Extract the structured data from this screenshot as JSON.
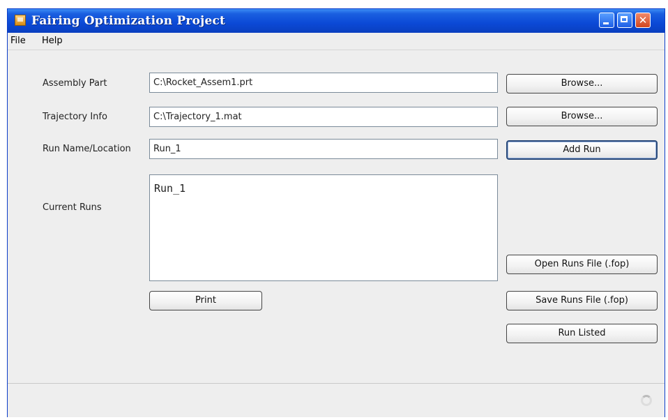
{
  "window": {
    "title": "Fairing Optimization Project"
  },
  "menu": {
    "items": [
      "File",
      "Help"
    ]
  },
  "form": {
    "assembly_label": "Assembly Part",
    "assembly_value": "C:\\Rocket_Assem1.prt",
    "trajectory_label": "Trajectory Info",
    "trajectory_value": "C:\\Trajectory_1.mat",
    "run_name_label": "Run Name/Location",
    "run_name_value": "Run_1",
    "current_runs_label": "Current Runs",
    "current_runs_text": "Run_1"
  },
  "buttons": {
    "browse_assembly": "Browse...",
    "browse_trajectory": "Browse...",
    "add_run": "Add Run",
    "open_runs": "Open Runs File (.fop)",
    "save_runs": "Save Runs File (.fop)",
    "run_listed": "Run Listed",
    "print": "Print"
  },
  "icons": {
    "app": "app-icon",
    "minimize": "minimize-icon",
    "maximize": "maximize-icon",
    "close": "close-icon",
    "busy": "busy-spinner-icon"
  },
  "colors": {
    "titlebar": "#0b49d6",
    "window_bg": "#eeeeee",
    "close_button": "#d0441e"
  }
}
